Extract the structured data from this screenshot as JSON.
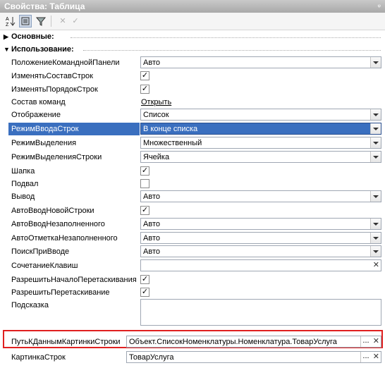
{
  "title": "Свойства: Таблица",
  "pin": "ᵠ",
  "toolbar": {
    "sort_icon": "A-Z sort icon",
    "categories_icon": "categories icon",
    "filter_icon": "filter icon",
    "clear_icon": "✕",
    "apply_icon": "✓"
  },
  "groups": {
    "main": "Основные:",
    "usage": "Использование:"
  },
  "props": {
    "p1": {
      "label": "ПоложениеКоманднойПанели",
      "value": "Авто"
    },
    "p2": {
      "label": "ИзменятьСоставСтрок",
      "checked": "✓"
    },
    "p3": {
      "label": "ИзменятьПорядокСтрок",
      "checked": "✓"
    },
    "p4": {
      "label": "Состав команд",
      "link": "Открыть"
    },
    "p5": {
      "label": "Отображение",
      "value": "Список"
    },
    "p6": {
      "label": "РежимВводаСтрок",
      "value": "В конце списка"
    },
    "p7": {
      "label": "РежимВыделения",
      "value": "Множественный"
    },
    "p8": {
      "label": "РежимВыделенияСтроки",
      "value": "Ячейка"
    },
    "p9": {
      "label": "Шапка",
      "checked": "✓"
    },
    "p10": {
      "label": "Подвал",
      "checked": ""
    },
    "p11": {
      "label": "Вывод",
      "value": "Авто"
    },
    "p12": {
      "label": "АвтоВводНовойСтроки",
      "checked": "✓"
    },
    "p13": {
      "label": "АвтоВводНезаполненного",
      "value": "Авто"
    },
    "p14": {
      "label": "АвтоОтметкаНезаполненного",
      "value": "Авто"
    },
    "p15": {
      "label": "ПоискПриВводе",
      "value": "Авто"
    },
    "p16": {
      "label": "СочетаниеКлавиш",
      "clear": "✕"
    },
    "p17": {
      "label": "РазрешитьНачалоПеретаскивания",
      "checked": "✓"
    },
    "p18": {
      "label": "РазрешитьПеретаскивание",
      "checked": "✓"
    },
    "p19": {
      "label": "Подсказка"
    },
    "p20": {
      "label": "ПутьКДаннымКартинкиСтроки",
      "value": "Объект.СписокНоменклатуры.Номенклатура.ТоварУслуга",
      "dots": "...",
      "clear": "✕"
    },
    "p21": {
      "label": "КартинкаСтрок",
      "value": "ТоварУслуга",
      "dots": "...",
      "clear": "✕"
    }
  }
}
